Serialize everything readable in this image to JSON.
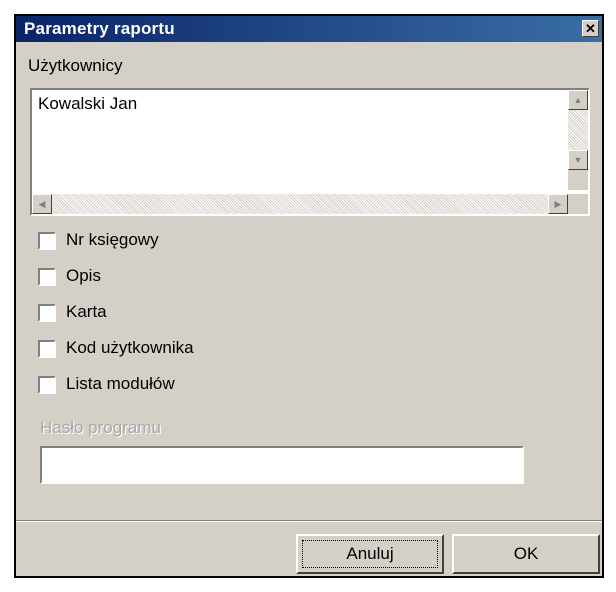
{
  "window": {
    "title": "Parametry raportu",
    "close_glyph": "✕"
  },
  "users": {
    "label": "Użytkownicy",
    "items": [
      "Kowalski Jan"
    ]
  },
  "options": [
    {
      "label": "Nr księgowy",
      "checked": false
    },
    {
      "label": "Opis",
      "checked": false
    },
    {
      "label": "Karta",
      "checked": false
    },
    {
      "label": "Kod użytkownika",
      "checked": false
    },
    {
      "label": "Lista modułów",
      "checked": false
    }
  ],
  "password": {
    "label": "Hasło programu",
    "value": "",
    "disabled": true
  },
  "buttons": {
    "cancel_label": "Anuluj",
    "ok_label": "OK"
  },
  "colors": {
    "title_bar": "#0a246a",
    "dialog_face": "#d4d0c8",
    "disabled_text": "#a8a8a8"
  }
}
